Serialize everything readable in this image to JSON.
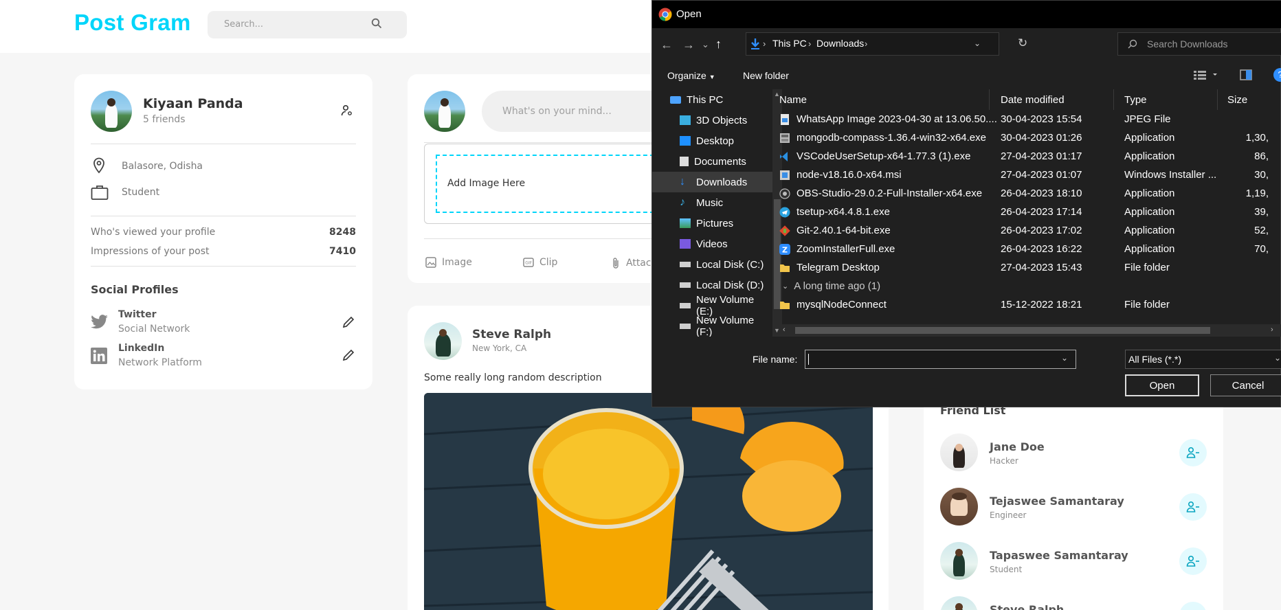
{
  "app": {
    "logo": "Post Gram",
    "search_placeholder": "Search..."
  },
  "profile": {
    "name": "Kiyaan Panda",
    "friends": "5 friends",
    "location": "Balasore, Odisha",
    "occupation": "Student",
    "stats": [
      {
        "label": "Who's viewed your profile",
        "value": "8248"
      },
      {
        "label": "Impressions of your post",
        "value": "7410"
      }
    ],
    "social_title": "Social Profiles",
    "socials": [
      {
        "name": "Twitter",
        "sub": "Social Network"
      },
      {
        "name": "LinkedIn",
        "sub": "Network Platform"
      }
    ]
  },
  "composer": {
    "placeholder": "What's on your mind...",
    "dropzone": "Add Image Here",
    "actions": [
      "Image",
      "Clip",
      "Attach"
    ]
  },
  "post": {
    "author": "Steve Ralph",
    "location": "New York, CA",
    "description": "Some really long random description"
  },
  "friends": {
    "title": "Friend List",
    "items": [
      {
        "name": "Jane Doe",
        "role": "Hacker"
      },
      {
        "name": "Tejaswee Samantaray",
        "role": "Engineer"
      },
      {
        "name": "Tapaswee Samantaray",
        "role": "Student"
      },
      {
        "name": "Steve Ralph",
        "role": ""
      }
    ]
  },
  "dialog": {
    "title": "Open",
    "breadcrumb": [
      "This PC",
      "Downloads"
    ],
    "search_placeholder": "Search Downloads",
    "organize": "Organize",
    "new_folder": "New folder",
    "nav": [
      "This PC",
      "3D Objects",
      "Desktop",
      "Documents",
      "Downloads",
      "Music",
      "Pictures",
      "Videos",
      "Local Disk (C:)",
      "Local Disk (D:)",
      "New Volume (E:)",
      "New Volume (F:)"
    ],
    "columns": {
      "name": "Name",
      "date": "Date modified",
      "type": "Type",
      "size": "Size"
    },
    "files": [
      {
        "name": "WhatsApp Image 2023-04-30 at 13.06.50....",
        "date": "30-04-2023 15:54",
        "type": "JPEG File",
        "size": "",
        "icon": "image-file-icon"
      },
      {
        "name": "mongodb-compass-1.36.4-win32-x64.exe",
        "date": "30-04-2023 01:26",
        "type": "Application",
        "size": "1,30,",
        "icon": "installer-icon"
      },
      {
        "name": "VSCodeUserSetup-x64-1.77.3 (1).exe",
        "date": "27-04-2023 01:17",
        "type": "Application",
        "size": "86,",
        "icon": "vscode-icon"
      },
      {
        "name": "node-v18.16.0-x64.msi",
        "date": "27-04-2023 01:07",
        "type": "Windows Installer ...",
        "size": "30,",
        "icon": "msi-icon"
      },
      {
        "name": "OBS-Studio-29.0.2-Full-Installer-x64.exe",
        "date": "26-04-2023 18:10",
        "type": "Application",
        "size": "1,19,",
        "icon": "obs-icon"
      },
      {
        "name": "tsetup-x64.4.8.1.exe",
        "date": "26-04-2023 17:14",
        "type": "Application",
        "size": "39,",
        "icon": "telegram-icon"
      },
      {
        "name": "Git-2.40.1-64-bit.exe",
        "date": "26-04-2023 17:02",
        "type": "Application",
        "size": "52,",
        "icon": "git-icon"
      },
      {
        "name": "ZoomInstallerFull.exe",
        "date": "26-04-2023 16:22",
        "type": "Application",
        "size": "70,",
        "icon": "zoom-icon"
      },
      {
        "name": "Telegram Desktop",
        "date": "27-04-2023 15:43",
        "type": "File folder",
        "size": "",
        "icon": "folder-icon"
      }
    ],
    "group_label": "A long time ago (1)",
    "older_files": [
      {
        "name": "mysqlNodeConnect",
        "date": "15-12-2022 18:21",
        "type": "File folder",
        "size": "",
        "icon": "folder-icon"
      }
    ],
    "filename_label": "File name:",
    "filename_value": "",
    "filetype": "All Files (*.*)",
    "open_btn": "Open",
    "cancel_btn": "Cancel"
  },
  "colors": {
    "accent": "#00d5fa",
    "accent_light": "#e3fafe",
    "dialog_bg": "#202020"
  }
}
